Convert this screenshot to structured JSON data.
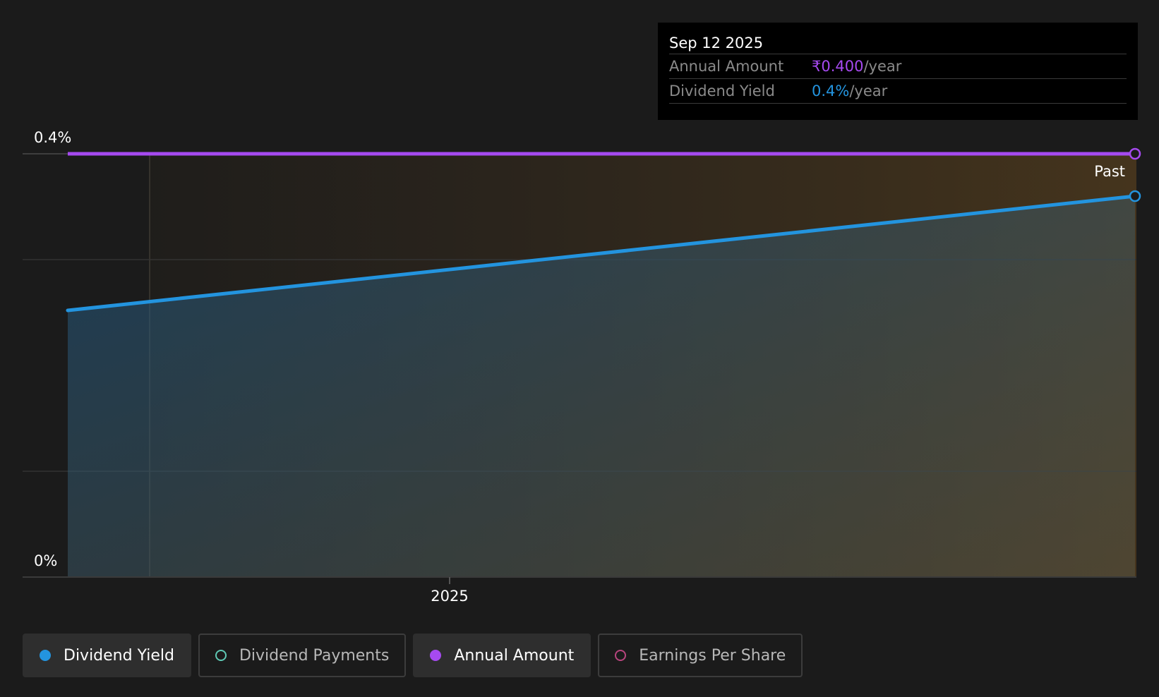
{
  "tooltip": {
    "date": "Sep 12 2025",
    "rows": [
      {
        "label": "Annual Amount",
        "value": "₹0.400",
        "unit": "/year",
        "color": "#a64af0"
      },
      {
        "label": "Dividend Yield",
        "value": "0.4%",
        "unit": "/year",
        "color": "#2394df"
      }
    ]
  },
  "past_label": "Past",
  "legend": [
    {
      "label": "Dividend Yield",
      "color": "#2394df",
      "active": true,
      "filled": true
    },
    {
      "label": "Dividend Payments",
      "color": "#5fc9b5",
      "active": false,
      "filled": false
    },
    {
      "label": "Annual Amount",
      "color": "#a64af0",
      "active": true,
      "filled": true
    },
    {
      "label": "Earnings Per Share",
      "color": "#b8457e",
      "active": false,
      "filled": false
    }
  ],
  "chart_data": {
    "type": "line",
    "x_ticks": [
      "2025"
    ],
    "y_ticks": [
      "0.4%",
      "0%"
    ],
    "ylim": [
      0,
      0.4
    ],
    "grid": true,
    "series": [
      {
        "name": "Dividend Yield",
        "color": "#2394df",
        "x": [
          "2024-09-12",
          "2025-09-12"
        ],
        "values": [
          0.252,
          0.36
        ]
      },
      {
        "name": "Annual Amount",
        "color": "#a64af0",
        "x": [
          "2024-09-12",
          "2025-09-12"
        ],
        "values": [
          0.4,
          0.4
        ]
      }
    ]
  }
}
